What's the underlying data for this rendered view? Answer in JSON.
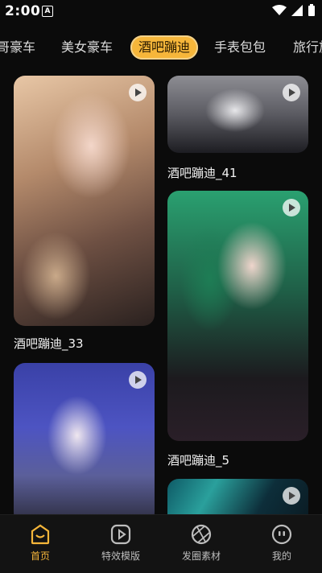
{
  "status": {
    "time": "2:00",
    "notify": "A",
    "faded_text": ""
  },
  "tabs": [
    {
      "label": "哥豪车"
    },
    {
      "label": "美女豪车"
    },
    {
      "label": "酒吧蹦迪",
      "active": true
    },
    {
      "label": "手表包包"
    },
    {
      "label": "旅行旅"
    }
  ],
  "feed": {
    "left": [
      {
        "title": "酒吧蹦迪_33"
      },
      {
        "title": ""
      }
    ],
    "right": [
      {
        "title": "酒吧蹦迪_41"
      },
      {
        "title": "酒吧蹦迪_5"
      },
      {
        "title": ""
      }
    ]
  },
  "nav": {
    "items": [
      {
        "label": "首页",
        "icon": "home-icon",
        "active": true
      },
      {
        "label": "特效模版",
        "icon": "play-icon"
      },
      {
        "label": "发圈素材",
        "icon": "aperture-icon"
      },
      {
        "label": "我的",
        "icon": "profile-icon"
      }
    ]
  },
  "colors": {
    "accent": "#f6b63a",
    "background": "#0b0b0b"
  }
}
